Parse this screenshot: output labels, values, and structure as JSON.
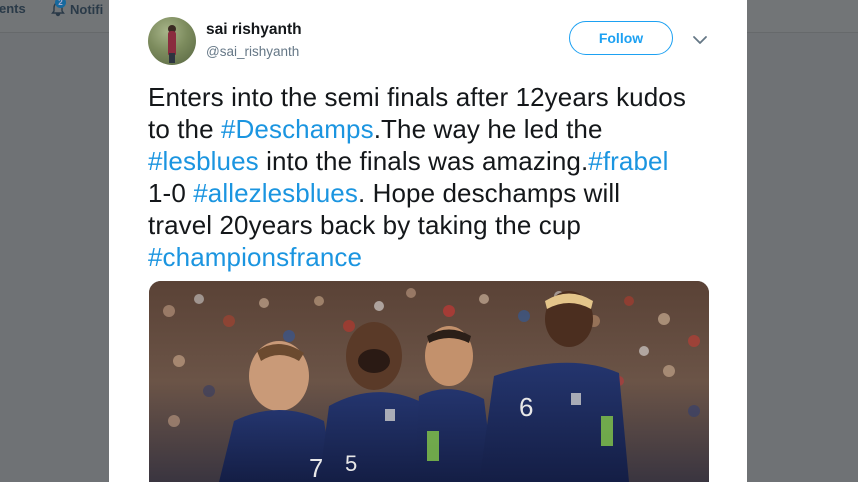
{
  "nav": {
    "moments_label": "ents",
    "notifications_label": "Notifi",
    "notification_badge": "2",
    "bell_icon": "bell-icon"
  },
  "tweet": {
    "display_name": "sai rishyanth",
    "handle": "@sai_rishyanth",
    "follow_label": "Follow",
    "text_lines": [
      [
        {
          "t": "Enters into the semi finals after 12years kudos",
          "tag": false
        }
      ],
      [
        {
          "t": "to the ",
          "tag": false
        },
        {
          "t": "#Deschamps",
          "tag": true
        },
        {
          "t": ".The way he led the",
          "tag": false
        }
      ],
      [
        {
          "t": "#lesblues",
          "tag": true
        },
        {
          "t": " into the finals was amazing.",
          "tag": false
        },
        {
          "t": "#frabel",
          "tag": true
        }
      ],
      [
        {
          "t": "1-0 ",
          "tag": false
        },
        {
          "t": "#allezlesblues",
          "tag": true
        },
        {
          "t": ". Hope deschamps will",
          "tag": false
        }
      ],
      [
        {
          "t": "travel 20years back by taking the cup",
          "tag": false
        }
      ],
      [
        {
          "t": "#championsfrance",
          "tag": true
        }
      ]
    ],
    "photo": {
      "jersey_numbers": [
        "7",
        "5",
        "6"
      ]
    }
  },
  "colors": {
    "accent": "#1da1f2",
    "hashtag": "#1b95e0",
    "overlay": "#6f7275",
    "jersey": "#1b2a5c"
  }
}
